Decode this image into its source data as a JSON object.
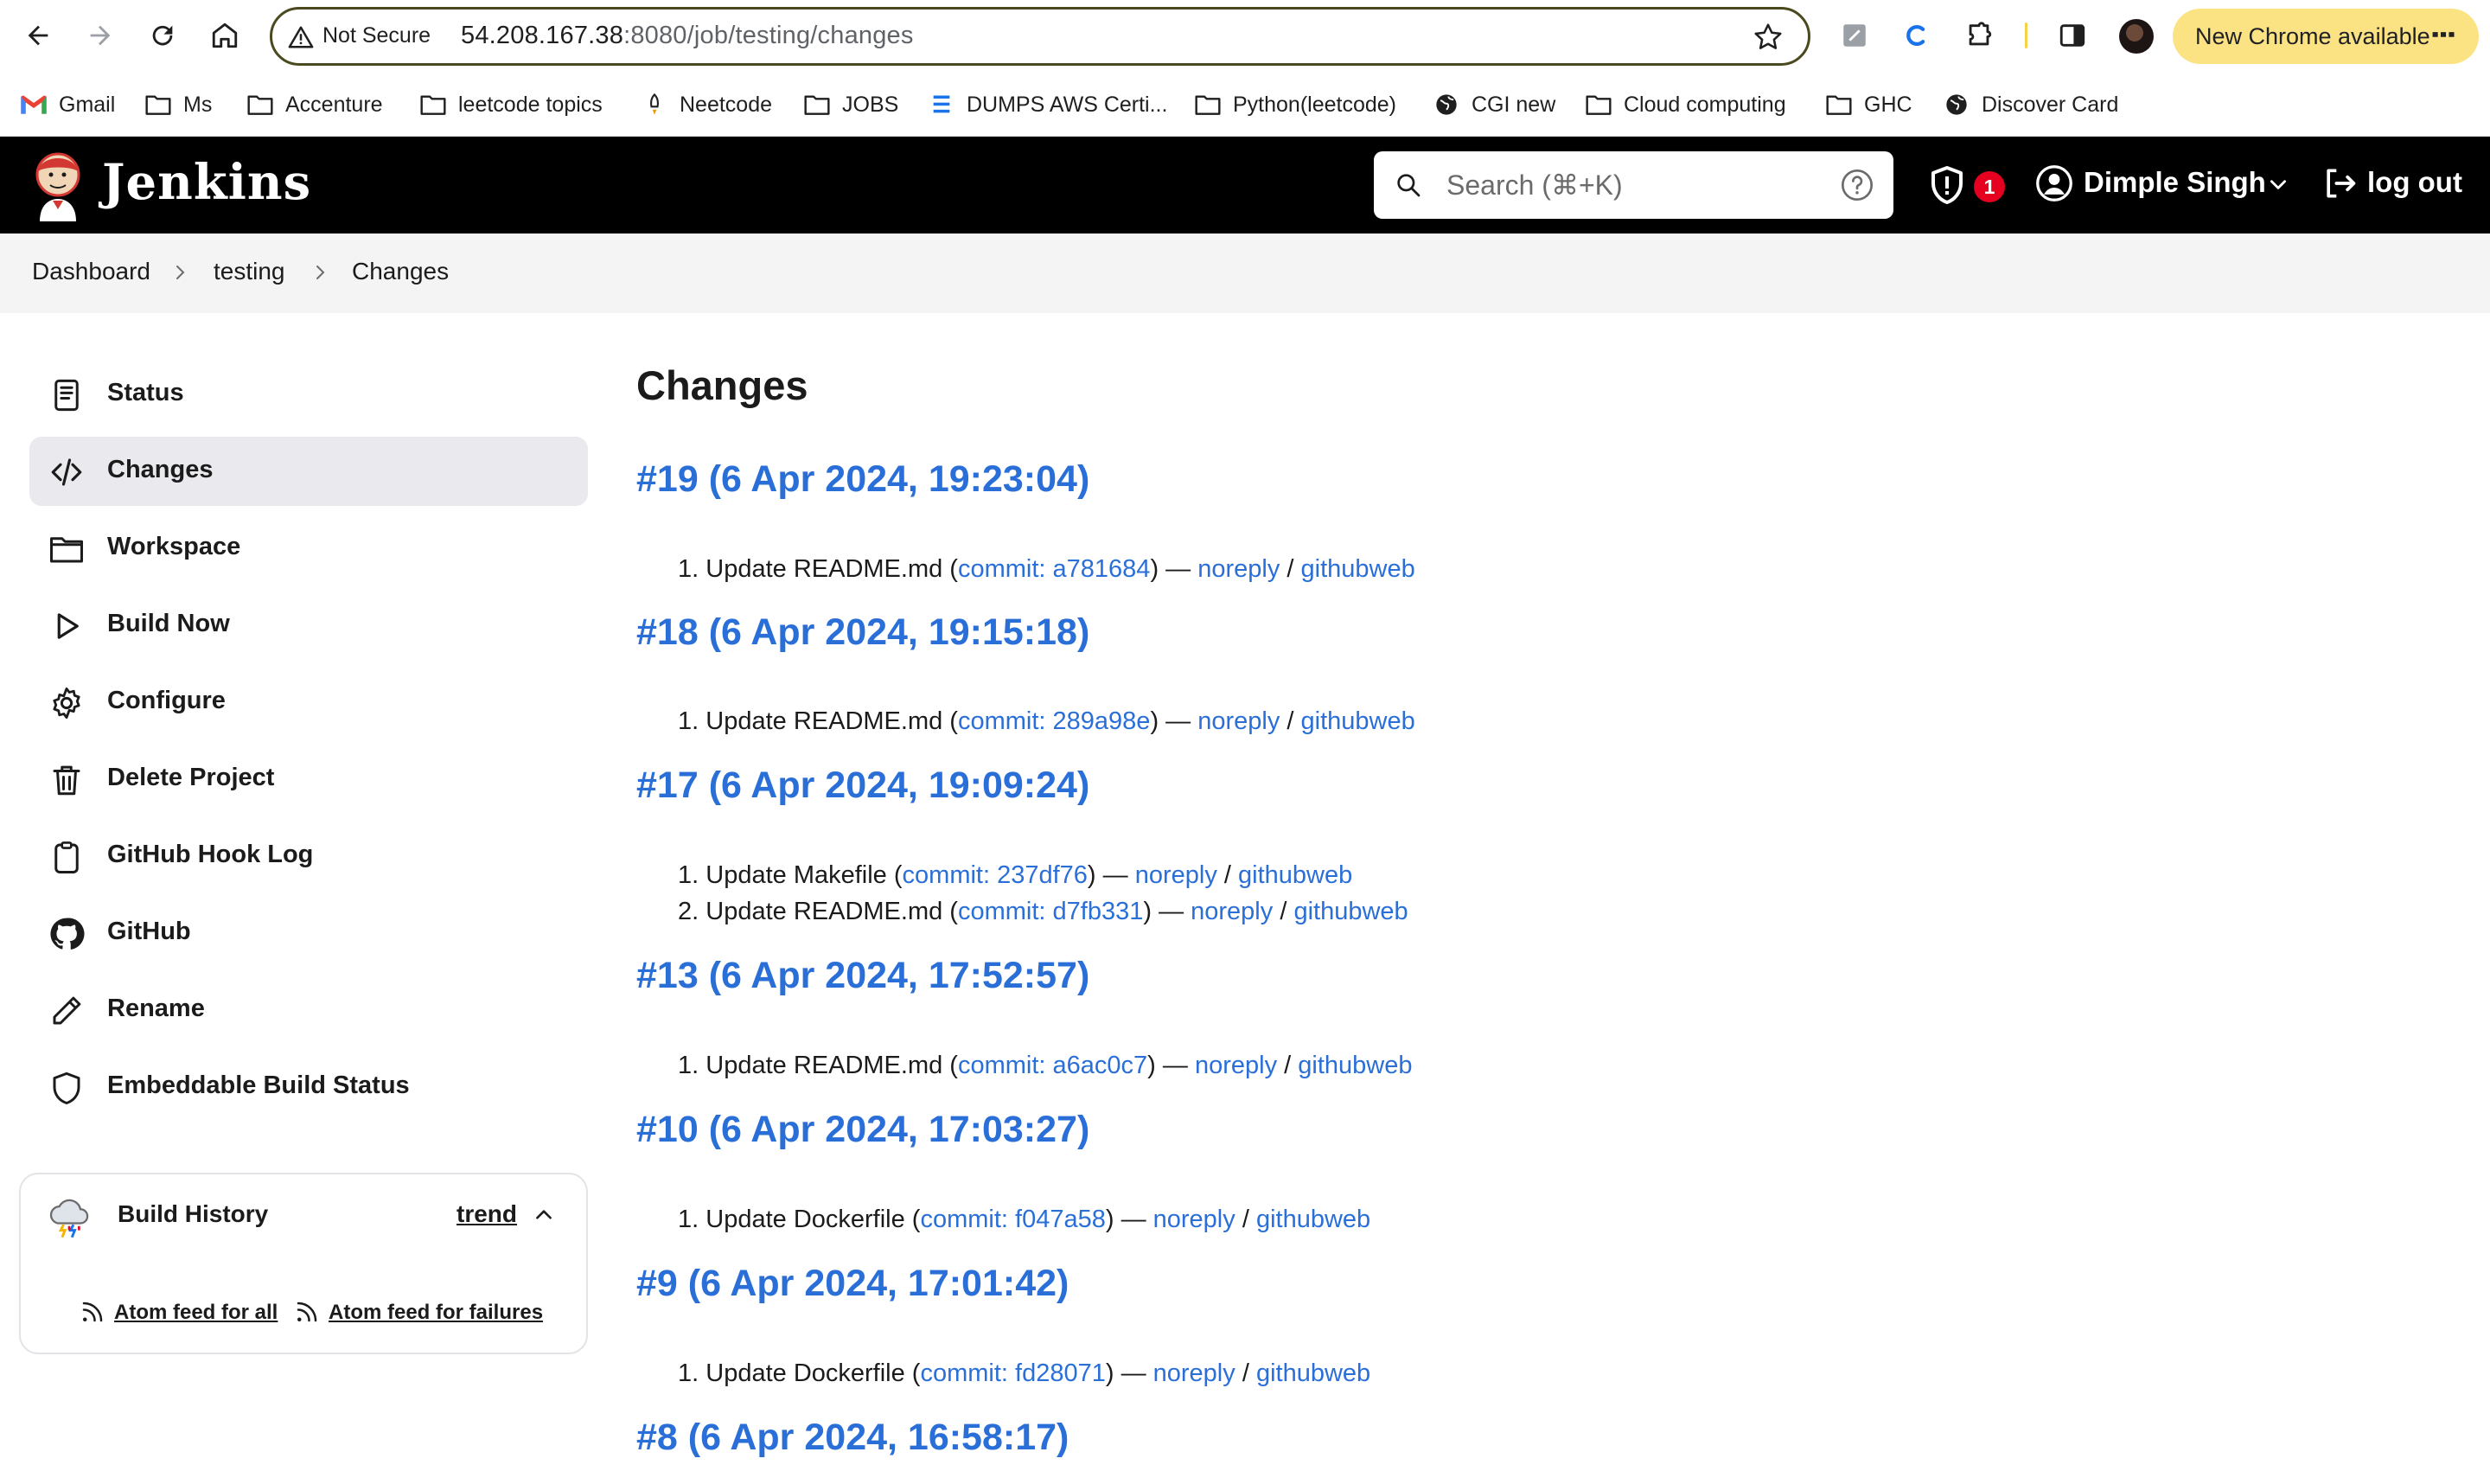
{
  "browser": {
    "not_secure": "Not Secure",
    "url_host": "54.208.167.38",
    "url_rest": ":8080/job/testing/changes",
    "update_label": "New Chrome available"
  },
  "bookmarks": [
    {
      "label": "Gmail",
      "icon": "gmail-icon"
    },
    {
      "label": "Ms",
      "icon": "folder-icon"
    },
    {
      "label": "Accenture",
      "icon": "folder-icon"
    },
    {
      "label": "leetcode topics",
      "icon": "folder-icon"
    },
    {
      "label": "Neetcode",
      "icon": "rocket-icon"
    },
    {
      "label": "JOBS",
      "icon": "folder-icon"
    },
    {
      "label": "DUMPS AWS Certi...",
      "icon": "lines-icon"
    },
    {
      "label": "Python(leetcode)",
      "icon": "folder-icon"
    },
    {
      "label": "CGI new",
      "icon": "globe-icon"
    },
    {
      "label": "Cloud computing",
      "icon": "folder-icon"
    },
    {
      "label": "GHC",
      "icon": "folder-icon"
    },
    {
      "label": "Discover Card",
      "icon": "globe-icon"
    }
  ],
  "header": {
    "title": "Jenkins",
    "search_placeholder": "Search (⌘+K)",
    "alerts_count": "1",
    "user": "Dimple Singh",
    "logout": "log out"
  },
  "breadcrumb": [
    "Dashboard",
    "testing",
    "Changes"
  ],
  "sidebar": {
    "items": [
      {
        "label": "Status",
        "icon": "document-icon"
      },
      {
        "label": "Changes",
        "icon": "code-icon",
        "active": true
      },
      {
        "label": "Workspace",
        "icon": "folder-icon"
      },
      {
        "label": "Build Now",
        "icon": "play-icon"
      },
      {
        "label": "Configure",
        "icon": "gear-icon"
      },
      {
        "label": "Delete Project",
        "icon": "trash-icon"
      },
      {
        "label": "GitHub Hook Log",
        "icon": "clipboard-icon"
      },
      {
        "label": "GitHub",
        "icon": "github-icon"
      },
      {
        "label": "Rename",
        "icon": "pencil-icon"
      },
      {
        "label": "Embeddable Build Status",
        "icon": "shield-icon"
      }
    ],
    "build_history": {
      "title": "Build History",
      "trend": "trend",
      "feed_all": "Atom feed for all",
      "feed_failures": "Atom feed for failures"
    }
  },
  "main": {
    "title": "Changes",
    "builds": [
      {
        "heading": "#19 (6 Apr 2024, 19:23:04)",
        "changes": [
          {
            "num": "1.",
            "msg": "Update README.md",
            "commit": "commit: a781684",
            "author": "noreply",
            "web": "githubweb"
          }
        ]
      },
      {
        "heading": "#18 (6 Apr 2024, 19:15:18)",
        "changes": [
          {
            "num": "1.",
            "msg": "Update README.md",
            "commit": "commit: 289a98e",
            "author": "noreply",
            "web": "githubweb"
          }
        ]
      },
      {
        "heading": "#17 (6 Apr 2024, 19:09:24)",
        "changes": [
          {
            "num": "1.",
            "msg": "Update Makefile",
            "commit": "commit: 237df76",
            "author": "noreply",
            "web": "githubweb"
          },
          {
            "num": "2.",
            "msg": "Update README.md",
            "commit": "commit: d7fb331",
            "author": "noreply",
            "web": "githubweb"
          }
        ]
      },
      {
        "heading": "#13 (6 Apr 2024, 17:52:57)",
        "changes": [
          {
            "num": "1.",
            "msg": "Update README.md",
            "commit": "commit: a6ac0c7",
            "author": "noreply",
            "web": "githubweb"
          }
        ]
      },
      {
        "heading": "#10 (6 Apr 2024, 17:03:27)",
        "changes": [
          {
            "num": "1.",
            "msg": "Update Dockerfile",
            "commit": "commit: f047a58",
            "author": "noreply",
            "web": "githubweb"
          }
        ]
      },
      {
        "heading": "#9 (6 Apr 2024, 17:01:42)",
        "changes": [
          {
            "num": "1.",
            "msg": "Update Dockerfile",
            "commit": "commit: fd28071",
            "author": "noreply",
            "web": "githubweb"
          }
        ]
      },
      {
        "heading": "#8 (6 Apr 2024, 16:58:17)",
        "changes": []
      }
    ]
  },
  "colors": {
    "link": "#2a6fd8",
    "header_bg": "#000000",
    "badge": "#e6001f",
    "update_chip": "#fbe384"
  }
}
